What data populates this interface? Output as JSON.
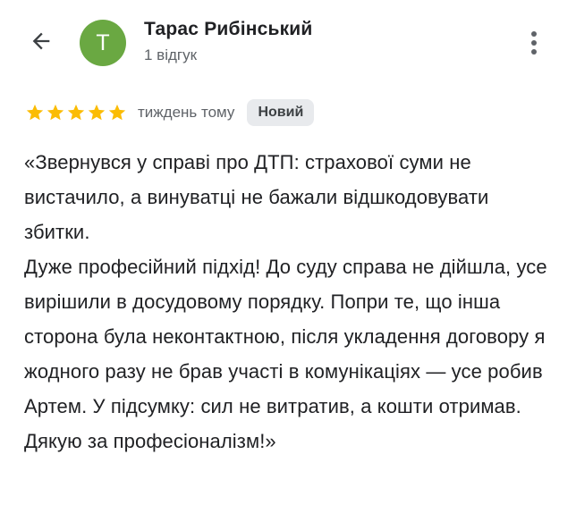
{
  "header": {
    "back_icon": "arrow-back-icon",
    "avatar_letter": "Т",
    "avatar_color": "#6aa842",
    "author_name": "Тарас Рибінський",
    "reviews_count": "1 відгук",
    "more_icon": "more-vertical-icon"
  },
  "review": {
    "rating": 5,
    "max_rating": 5,
    "star_color": "#fbbc04",
    "time": "тиждень тому",
    "badge": "Новий",
    "text": "«Звернувся у справі про ДТП: страхової суми не вистачило, а винуватці не бажали відшкодовувати збитки.\nДуже професійний підхід! До суду справа не дійшла, усе вирішили в досудовому порядку. Попри те, що інша сторона була неконтактною, після укладення договору я жодного разу не брав участі в комунікаціях — усе робив Артем. У підсумку: сил не витратив, а кошти отримав. Дякую за професіоналізм!»"
  }
}
